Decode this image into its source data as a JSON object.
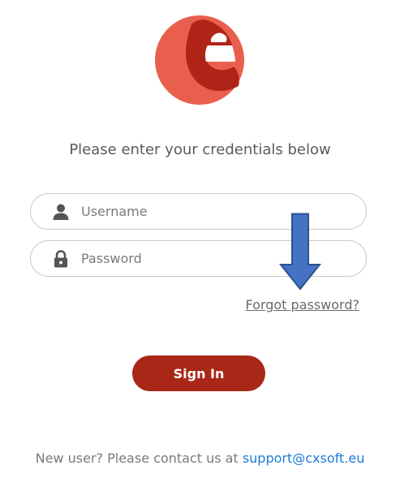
{
  "logo": {
    "icon": "e-logo-icon",
    "colors": {
      "light": "#e8604d",
      "dark": "#b02418"
    }
  },
  "login": {
    "prompt": "Please enter your credentials below",
    "username": {
      "placeholder": "Username",
      "value": "",
      "icon": "user-icon"
    },
    "password": {
      "placeholder": "Password",
      "value": "",
      "icon": "lock-icon"
    },
    "forgot_label": "Forgot password?",
    "signin_label": "Sign In",
    "signin_color": "#a82717"
  },
  "annotation": {
    "icon": "arrow-down-icon",
    "color": "#4472c4"
  },
  "footer": {
    "text": "New user? Please contact us at ",
    "email": "support@cxsoft.eu",
    "link_color": "#1e7bd6"
  }
}
